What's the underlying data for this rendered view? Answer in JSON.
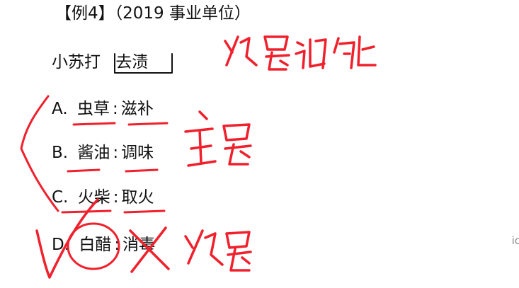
{
  "heading": {
    "tag": "【例4】",
    "source": "（2019 事业单位）"
  },
  "question": {
    "left": "小苏打",
    "right": "去渍"
  },
  "options": [
    {
      "letter": "A.",
      "left": "虫草",
      "sep": ":",
      "right": "滋补"
    },
    {
      "letter": "B.",
      "left": "酱油",
      "sep": ":",
      "right": "调味"
    },
    {
      "letter": "C.",
      "left": "火柴",
      "sep": ":",
      "right": "取火"
    },
    {
      "letter": "D.",
      "left": "白醋",
      "sep": ":",
      "right": "消毒"
    }
  ],
  "edge_text": "ic",
  "handwriting": {
    "note_top": "次要功能",
    "note_main": "主要",
    "note_bottom": "次要"
  },
  "colors": {
    "ink": "#f0202c",
    "text": "#111111",
    "box": "#111111"
  }
}
